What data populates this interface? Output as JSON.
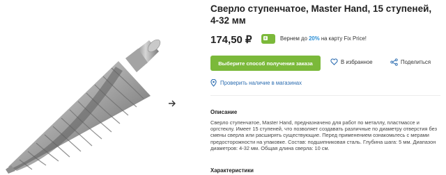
{
  "product": {
    "title": "Сверло ступенчатое, Master Hand, 15 ступеней, 4-32 мм",
    "price": "174,50 ₽",
    "cashback": {
      "prefix": "Вернем до ",
      "percent": "20%",
      "suffix": " на карту Fix Price!"
    }
  },
  "actions": {
    "order_label": "Выберите способ получения заказа",
    "favorite_label": "В избранное",
    "share_label": "Поделиться",
    "check_stores_label": "Проверить наличие в магазинах"
  },
  "description": {
    "heading": "Описание",
    "text": "Сверло ступенчатое, Master Hand, предназначено для работ по металлу, пластмассе и оргстеклу. Имеет 15 ступеней, что позволяет создавать различные по диаметру отверстия без смены сверла или расширять существующие. Перед применением ознакомьтесь с мерами предосторожности на упаковке. Состав: подшипниковая сталь. Глубина шага: 5 мм. Диапазон диаметров: 4-32 мм. Общая длина сверла: 10 см."
  },
  "characteristics": {
    "heading": "Характеристики"
  },
  "colors": {
    "accent_green": "#7bb93a",
    "link_blue": "#2b6cb0",
    "cashback_blue": "#2b8fd6"
  },
  "icons": {
    "gallery_next": "chevron-right-icon",
    "favorite": "heart-icon",
    "share": "share-icon",
    "location": "location-pin-icon",
    "cashback": "fix-price-card-icon"
  }
}
